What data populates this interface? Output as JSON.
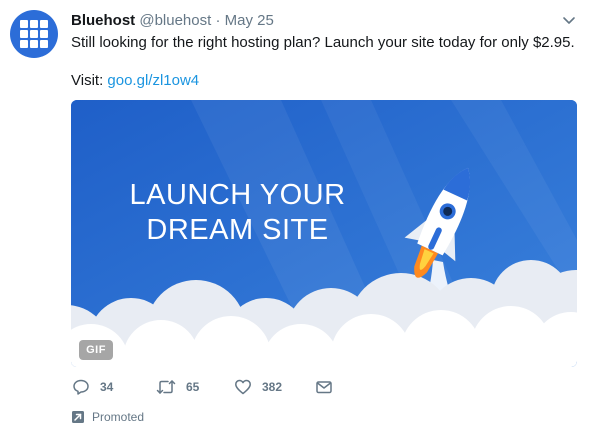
{
  "account": {
    "name": "Bluehost",
    "handle": "@bluehost",
    "separator": "·",
    "date": "May 25"
  },
  "tweet": {
    "text": "Still looking for the right hosting plan? Launch your site today for only $2.95.",
    "visit_label": "Visit: ",
    "link_text": "goo.gl/zl1ow4"
  },
  "media": {
    "headline_line1": "LAUNCH YOUR",
    "headline_line2": "DREAM SITE",
    "badge": "GIF",
    "background_color": "#2f74d6"
  },
  "actions": {
    "reply_count": "34",
    "retweet_count": "65",
    "like_count": "382"
  },
  "promoted_label": "Promoted",
  "colors": {
    "brand_blue": "#2c6dd8",
    "link": "#1b95e0",
    "muted": "#657786"
  },
  "icons": [
    "grid-logo-icon",
    "chevron-down-icon",
    "reply-icon",
    "retweet-icon",
    "heart-icon",
    "message-icon",
    "promoted-arrow-icon",
    "rocket-icon"
  ]
}
